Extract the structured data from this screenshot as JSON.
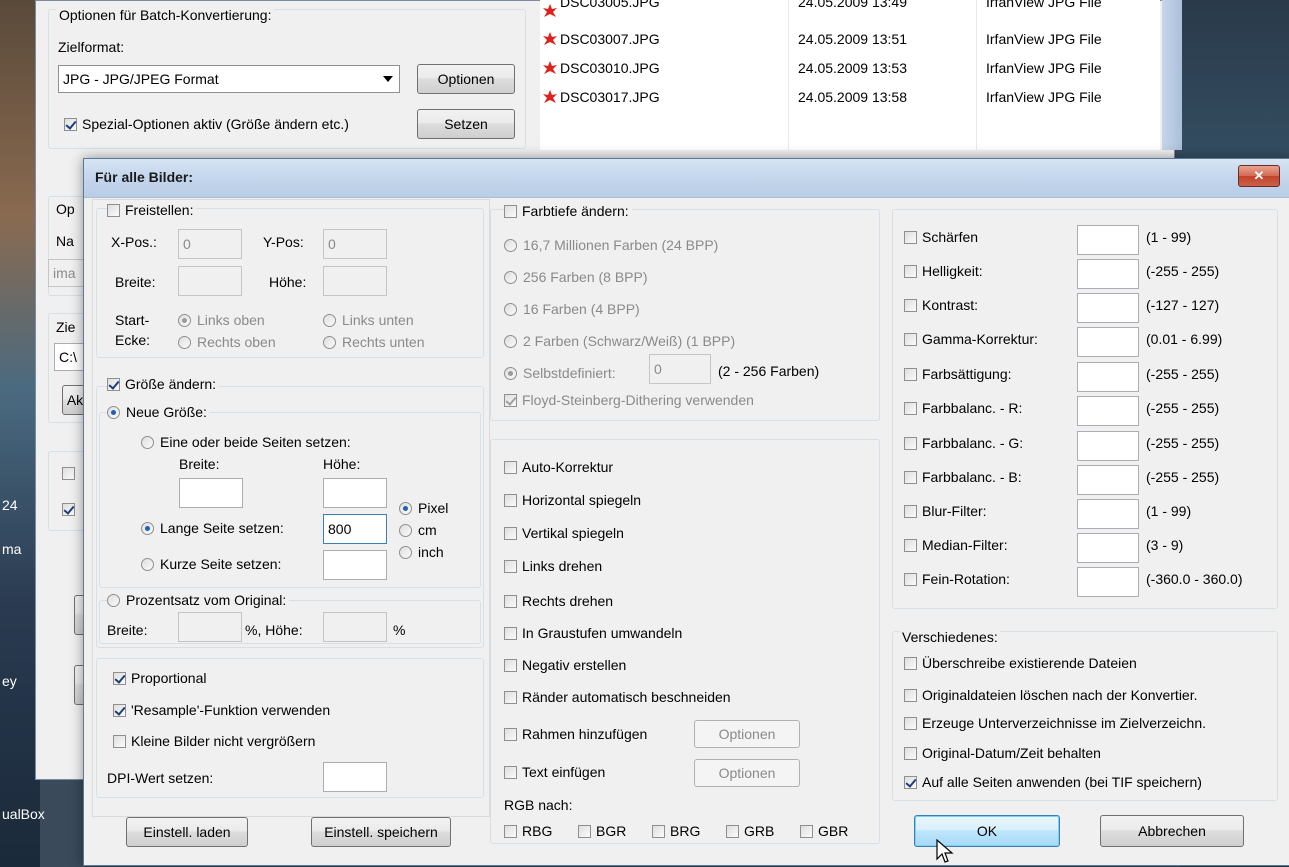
{
  "desktop": {
    "left_labels": [
      "24",
      "ma",
      "ey",
      "ualBox"
    ]
  },
  "back_window": {
    "batch_group_title": "Optionen für Batch-Konvertierung:",
    "zielformat_label": "Zielformat:",
    "format_value": "JPG - JPG/JPEG Format",
    "optionen_button": "Optionen",
    "spezial_label": "Spezial-Optionen aktiv (Größe ändern etc.)",
    "setzen_button": "Setzen",
    "partial_labels": [
      "Op",
      "Na",
      "ima",
      "Zie",
      "C:\\",
      "Ak"
    ]
  },
  "file_list": [
    {
      "name": "DSC03005.JPG",
      "date": "24.05.2009 13:49",
      "type": "IrfanView JPG File"
    },
    {
      "name": "DSC03007.JPG",
      "date": "24.05.2009 13:51",
      "type": "IrfanView JPG File"
    },
    {
      "name": "DSC03010.JPG",
      "date": "24.05.2009 13:53",
      "type": "IrfanView JPG File"
    },
    {
      "name": "DSC03017.JPG",
      "date": "24.05.2009 13:58",
      "type": "IrfanView JPG File"
    }
  ],
  "dialog": {
    "title": "Für alle Bilder:",
    "close_glyph": "✕",
    "crop": {
      "label": "Freistellen:",
      "xpos_label": "X-Pos.:",
      "xpos_value": "0",
      "ypos_label": "Y-Pos:",
      "ypos_value": "0",
      "width_label": "Breite:",
      "height_label": "Höhe:",
      "start_label_1": "Start-",
      "start_label_2": "Ecke:",
      "corners": [
        "Links oben",
        "Links unten",
        "Rechts oben",
        "Rechts unten"
      ]
    },
    "resize": {
      "label": "Größe ändern:",
      "neue_groesse": "Neue Größe:",
      "set_sides": "Eine oder beide Seiten setzen:",
      "width_label": "Breite:",
      "height_label": "Höhe:",
      "long_side": "Lange Seite setzen:",
      "long_side_value": "800",
      "short_side": "Kurze Seite setzen:",
      "units": [
        "Pixel",
        "cm",
        "inch"
      ],
      "percent": "Prozentsatz vom Original:",
      "pct_width_label": "Breite:",
      "pct_mid": "%,  Höhe:",
      "pct_end": "%",
      "proportional": "Proportional",
      "resample": "'Resample'-Funktion verwenden",
      "no_enlarge": "Kleine Bilder nicht vergrößern",
      "dpi": "DPI-Wert setzen:"
    },
    "buttons": {
      "load": "Einstell. laden",
      "save": "Einstell. speichern",
      "ok": "OK",
      "cancel": "Abbrechen",
      "options1": "Optionen",
      "options2": "Optionen"
    },
    "color_depth": {
      "label": "Farbtiefe ändern:",
      "options": [
        "16,7 Millionen Farben (24 BPP)",
        "256 Farben (8 BPP)",
        "16 Farben (4 BPP)",
        "2 Farben (Schwarz/Weiß) (1 BPP)"
      ],
      "custom": "Selbstdefiniert:",
      "custom_value": "0",
      "custom_range": "(2 - 256 Farben)",
      "dither": "Floyd-Steinberg-Dithering verwenden"
    },
    "transforms": [
      "Auto-Korrektur",
      "Horizontal spiegeln",
      "Vertikal spiegeln",
      "Links drehen",
      "Rechts drehen",
      "In Graustufen umwandeln",
      "Negativ erstellen",
      "Ränder automatisch beschneiden",
      "Rahmen hinzufügen",
      "Text einfügen"
    ],
    "rgb_label": "RGB nach:",
    "rgb_options": [
      "RBG",
      "BGR",
      "BRG",
      "GRB",
      "GBR"
    ],
    "filters": [
      {
        "label": "Schärfen",
        "range": "(1  -  99)"
      },
      {
        "label": "Helligkeit:",
        "range": "(-255  -  255)"
      },
      {
        "label": "Kontrast:",
        "range": "(-127  -  127)"
      },
      {
        "label": "Gamma-Korrektur:",
        "range": "(0.01  -  6.99)"
      },
      {
        "label": "Farbsättigung:",
        "range": "(-255  -  255)"
      },
      {
        "label": "Farbbalanc. - R:",
        "range": "(-255  -  255)"
      },
      {
        "label": "Farbbalanc. - G:",
        "range": "(-255  -  255)"
      },
      {
        "label": "Farbbalanc. - B:",
        "range": "(-255  -  255)"
      },
      {
        "label": "Blur-Filter:",
        "range": "(1  -  99)"
      },
      {
        "label": "Median-Filter:",
        "range": "(3  -  9)"
      },
      {
        "label": "Fein-Rotation:",
        "range": "(-360.0  -  360.0)"
      }
    ],
    "misc": {
      "label": "Verschiedenes:",
      "items": [
        "Überschreibe existierende Dateien",
        "Originaldateien löschen nach der Konvertier.",
        "Erzeuge Unterverzeichnisse im Zielverzeichn.",
        "Original-Datum/Zeit behalten",
        "Auf alle Seiten anwenden (bei TIF speichern)"
      ]
    }
  }
}
